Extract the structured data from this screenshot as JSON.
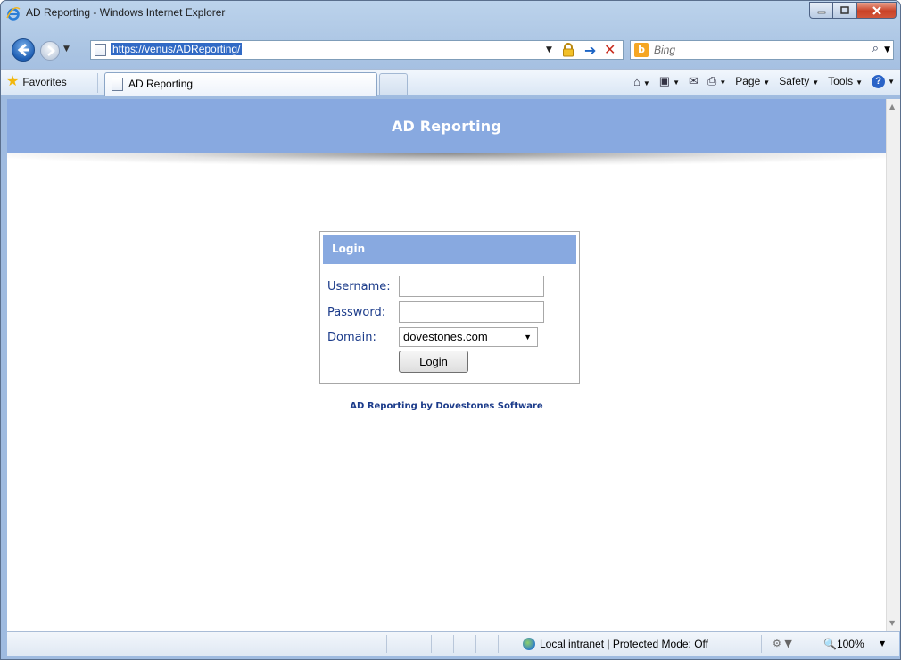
{
  "window": {
    "title": "AD Reporting - Windows Internet Explorer"
  },
  "address": {
    "url": "https://venus/ADReporting/",
    "search_placeholder": "Bing"
  },
  "favorites_bar": {
    "favorites_label": "Favorites",
    "tab_label": "AD Reporting"
  },
  "commandbar": {
    "page_label": "Page",
    "safety_label": "Safety",
    "tools_label": "Tools"
  },
  "page": {
    "header_title": "AD Reporting",
    "login": {
      "heading": "Login",
      "username_label": "Username:",
      "username_value": "",
      "password_label": "Password:",
      "password_value": "",
      "domain_label": "Domain:",
      "domain_value": "dovestones.com",
      "button_label": "Login"
    },
    "footer_credit": "AD Reporting by Dovestones Software"
  },
  "statusbar": {
    "zone_text": "Local intranet | Protected Mode: Off",
    "zoom_text": "100%"
  },
  "colors": {
    "header_bg": "#88a9e0",
    "label_text": "#1b3b8a"
  }
}
